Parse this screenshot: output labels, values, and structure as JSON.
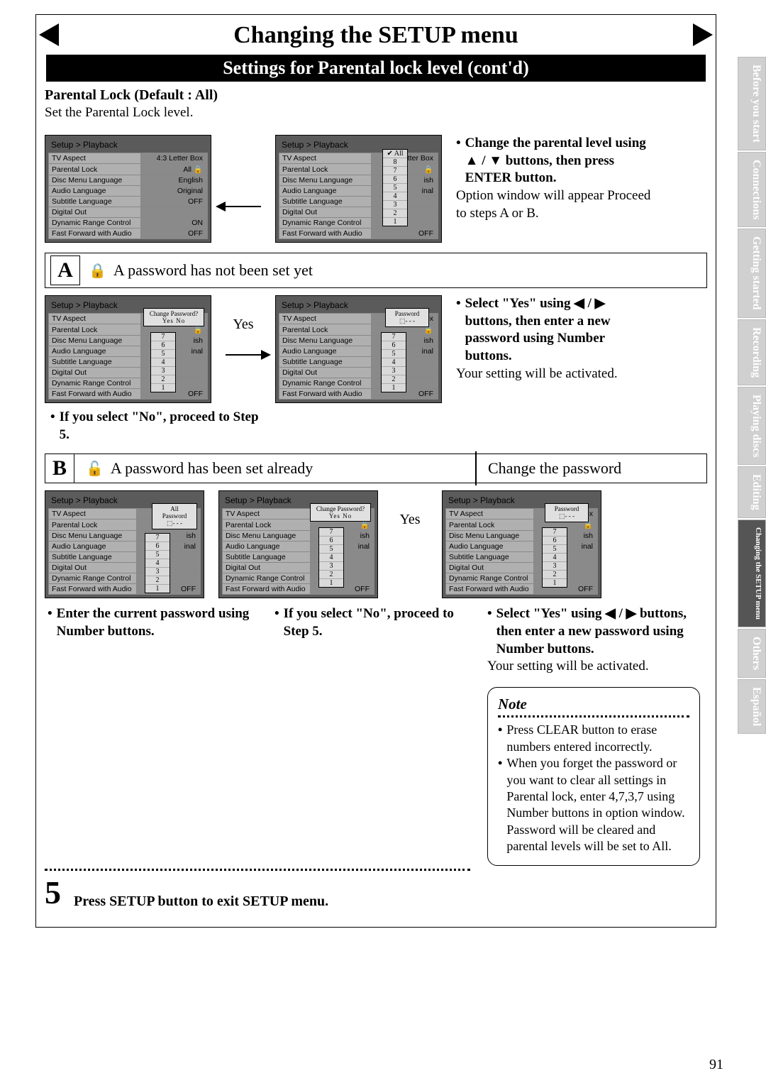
{
  "page_number": "91",
  "banner_title": "Changing the SETUP menu",
  "sub_banner": "Settings for Parental lock level (cont'd)",
  "intro": {
    "heading": "Parental Lock (Default : All)",
    "text": "Set the Parental Lock level."
  },
  "right1": {
    "l1": "Change the parental level using ▲ / ▼ buttons, then press ENTER button.",
    "l2": "Option window will appear Proceed to steps A or B."
  },
  "sectA": {
    "letter": "A",
    "lockicon": "🔒",
    "heading": "A password has not been set yet",
    "after_no": "If you select \"No\", proceed to Step 5.",
    "yes_label": "Yes",
    "instr1": "Select \"Yes\" using ◀ / ▶ buttons, then enter a new password using Number buttons.",
    "instr2": "Your setting will be activated."
  },
  "sectB": {
    "letter": "B",
    "lockicon": "🔓",
    "heading_left": "A password has been set already",
    "heading_right": "Change the password",
    "yes_label": "Yes",
    "instr_left": "Enter the current password using Number buttons.",
    "instr_mid": "If you select \"No\", proceed to Step 5.",
    "instr_r1": "Select \"Yes\" using ◀ / ▶ buttons, then enter a new password using Number buttons.",
    "instr_r2": "Your setting will be activated."
  },
  "step5": {
    "num": "5",
    "text": "Press SETUP button to exit SETUP menu."
  },
  "note": {
    "title": "Note",
    "b1": "Press CLEAR button to erase numbers entered incorrectly.",
    "b2": "When you forget the password or you want to clear all settings in Parental lock, enter 4,7,3,7 using Number buttons in option window. Password will be cleared and parental levels will be set to All."
  },
  "setup": {
    "crumb": "Setup > Playback",
    "rows": [
      {
        "l": "TV Aspect",
        "v": "4:3 Letter Box"
      },
      {
        "l": "Parental Lock",
        "v": "All  🔒"
      },
      {
        "l": "Disc Menu Language",
        "v": "English"
      },
      {
        "l": "Audio Language",
        "v": "Original"
      },
      {
        "l": "Subtitle Language",
        "v": "OFF"
      },
      {
        "l": "Digital Out",
        "v": ""
      },
      {
        "l": "Dynamic Range Control",
        "v": "ON"
      },
      {
        "l": "Fast Forward with Audio",
        "v": "OFF"
      }
    ],
    "short_vals": [
      "etter Box",
      "🔒",
      "ish",
      "inal",
      "",
      "",
      "",
      ""
    ],
    "levels_all": [
      "✔ All",
      "8",
      "7",
      "6",
      "5",
      "4",
      "3",
      "2",
      "1"
    ],
    "levels_7": [
      "7",
      "6",
      "5",
      "4",
      "3",
      "2",
      "1"
    ],
    "change_pw": "Change Password?",
    "yesno": "Yes    No",
    "password": "Password",
    "pwval": "⬚- - -",
    "row_off": "OFF",
    "val_all": "All"
  },
  "tabs": [
    "Before you start",
    "Connections",
    "Getting started",
    "Recording",
    "Playing discs",
    "Editing",
    "Changing the SETUP menu",
    "Others",
    "Español"
  ]
}
